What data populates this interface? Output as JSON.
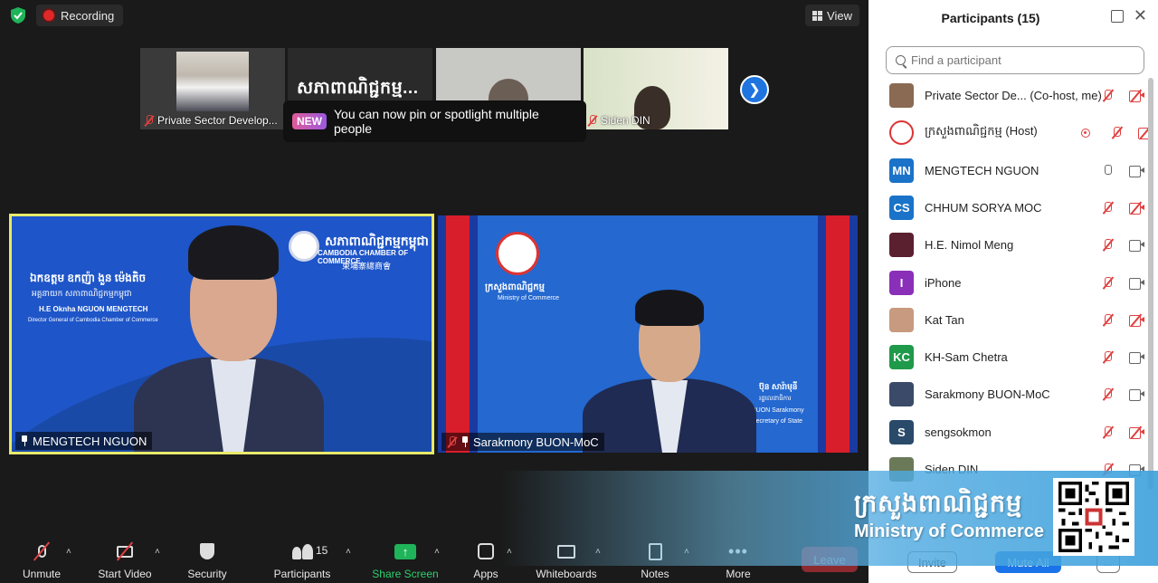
{
  "topbar": {
    "recording_label": "Recording",
    "view_label": "View"
  },
  "thumbnails": [
    {
      "name": "Private Sector Develop...",
      "muted": true
    },
    {
      "name": "",
      "title_text": "សភាពាណិជ្ជកម្ម...",
      "muted": false
    },
    {
      "name": "",
      "muted": false
    },
    {
      "name": "Siden DIN",
      "muted": true
    }
  ],
  "tooltip": {
    "badge": "NEW",
    "text": "You can now pin or spotlight multiple people"
  },
  "videos": {
    "left": {
      "name": "MENGTECH NGUON",
      "chamber_kh": "សភាពាណិជ្ជកម្មកម្ពុជា",
      "chamber_en": "CAMBODIA CHAMBER OF COMMERCE",
      "chamber_cn": "柬埔寨總商會",
      "title_kh": "ឯកឧត្តម ឧកញ៉ា ងួន ម៉េងតិច",
      "title_kh2": "អគ្គនាយក សភាពាណិជ្ជកម្មកម្ពុជា",
      "title_en": "H.E Oknha NGUON MENGTECH",
      "title_en2": "Director General of Cambodia Chamber of Commerce"
    },
    "right": {
      "name": "Sarakmony BUON-MoC",
      "ministry_kh": "ក្រសួងពាណិជ្ជកម្ម",
      "ministry_en": "Ministry of Commerce",
      "person_kh": "ប៊ុន សារ៉ាមុនី",
      "person_kh2": "រដ្ឋលេខាធិការ",
      "person_en": "BUON Sarakmony",
      "person_en2": "Secretary of State"
    }
  },
  "toolbar": {
    "unmute": "Unmute",
    "start_video": "Start Video",
    "security": "Security",
    "participants": "Participants",
    "participants_count": "15",
    "share_screen": "Share Screen",
    "apps": "Apps",
    "whiteboards": "Whiteboards",
    "notes": "Notes",
    "more": "More",
    "leave": "Leave"
  },
  "panel": {
    "title": "Participants (15)",
    "search_placeholder": "Find a participant",
    "participants": [
      {
        "name": "Private Sector De... (Co-host, me)",
        "avatar": "",
        "avatar_color": "#8a6a52",
        "mic": "off",
        "cam": "off",
        "rec": false
      },
      {
        "name": "ក្រសួងពាណិជ្ជកម្ម (Host)",
        "avatar": "",
        "avatar_color": "#ffffff",
        "mic": "off",
        "cam": "off",
        "rec": true
      },
      {
        "name": "MENGTECH NGUON",
        "avatar": "MN",
        "avatar_color": "#1a73c8",
        "mic": "on",
        "cam": "on",
        "rec": false
      },
      {
        "name": "CHHUM SORYA MOC",
        "avatar": "CS",
        "avatar_color": "#1a73c8",
        "mic": "off",
        "cam": "off",
        "rec": false
      },
      {
        "name": "H.E. Nimol Meng",
        "avatar": "",
        "avatar_color": "#5a2030",
        "mic": "off",
        "cam": "on",
        "rec": false
      },
      {
        "name": "iPhone",
        "avatar": "I",
        "avatar_color": "#8a2fb8",
        "mic": "off",
        "cam": "on",
        "rec": false
      },
      {
        "name": "Kat Tan",
        "avatar": "",
        "avatar_color": "#c89a80",
        "mic": "off",
        "cam": "off",
        "rec": false
      },
      {
        "name": "KH-Sam Chetra",
        "avatar": "KC",
        "avatar_color": "#1e9a4a",
        "mic": "off",
        "cam": "on",
        "rec": false
      },
      {
        "name": "Sarakmony BUON-MoC",
        "avatar": "",
        "avatar_color": "#3a4a68",
        "mic": "off",
        "cam": "on",
        "rec": false
      },
      {
        "name": "sengsokmon",
        "avatar": "S",
        "avatar_color": "#2a4a6a",
        "mic": "off",
        "cam": "off",
        "rec": false
      },
      {
        "name": "Siden DIN",
        "avatar": "",
        "avatar_color": "#6a7a58",
        "mic": "off",
        "cam": "on",
        "rec": false
      }
    ],
    "invite": "Invite",
    "mute_all": "Mute All",
    "more": "..."
  },
  "overlay": {
    "kh": "ក្រសួងពាណិជ្ជកម្ម",
    "en": "Ministry of Commerce"
  },
  "colors": {
    "accent_blue": "#1a73e8",
    "share_green": "#2ecf6e",
    "mute_red": "#e04040",
    "active_speaker": "#e8ea6a"
  }
}
